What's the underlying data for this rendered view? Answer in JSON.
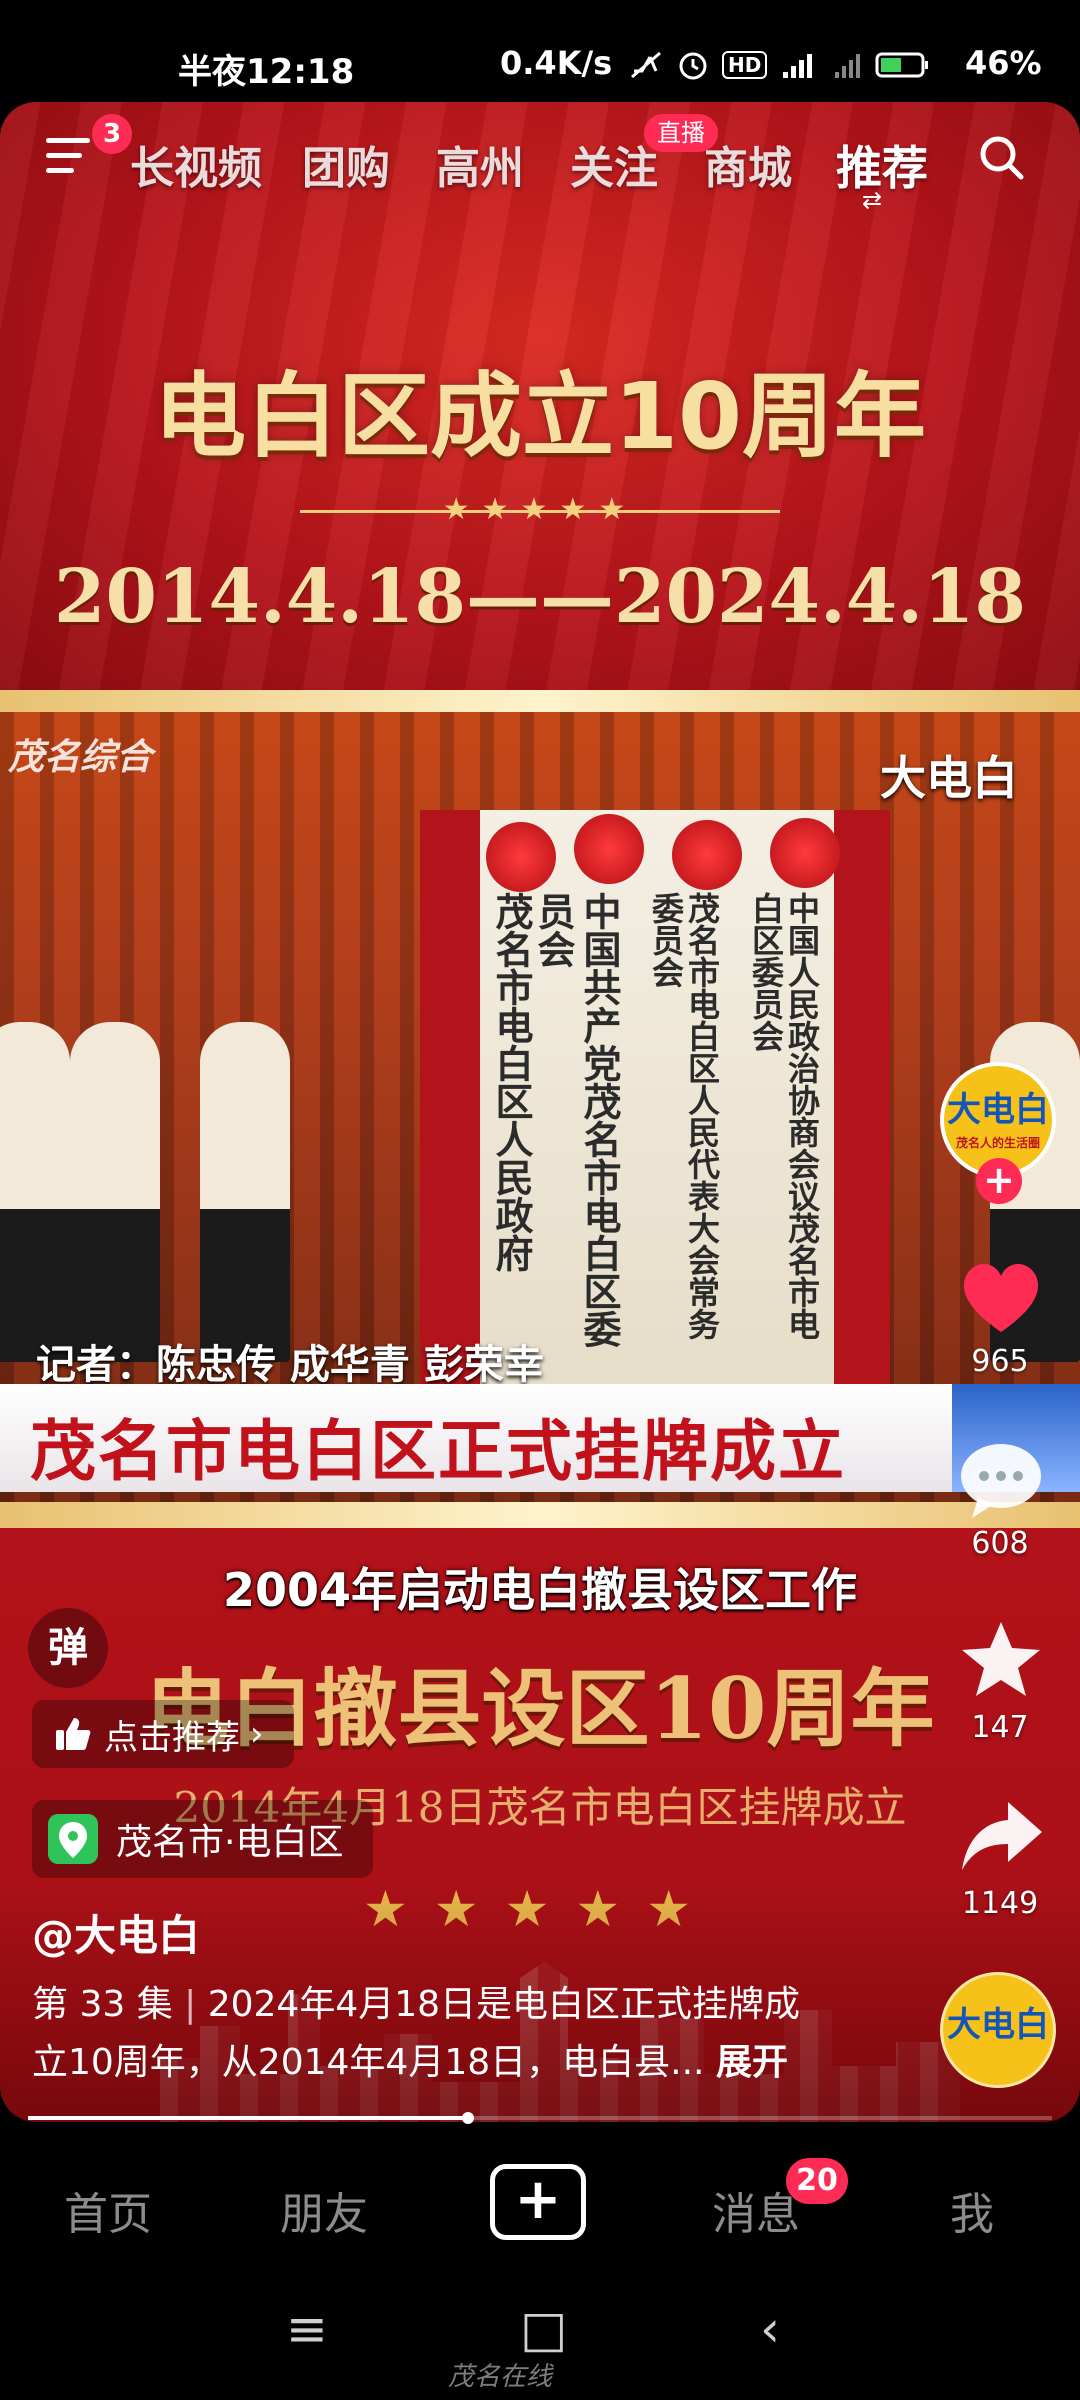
{
  "status_bar": {
    "time": "半夜12:18",
    "network_speed": "0.4K/s",
    "indicators": "HD 5G",
    "battery": "46%"
  },
  "top_nav": {
    "menu_badge": "3",
    "tabs": [
      {
        "label": "长视频"
      },
      {
        "label": "团购"
      },
      {
        "label": "高州"
      },
      {
        "label": "关注"
      },
      {
        "label": "商城"
      },
      {
        "label": "推荐"
      }
    ],
    "live_badge": "直播",
    "active_tab": "推荐"
  },
  "video": {
    "banner_title": "电白区成立10周年",
    "banner_stars": "★★★★★",
    "banner_dates": "2014.4.18——2024.4.18",
    "channel_logo": "茂名综合",
    "watermark": "大电白",
    "plaque_columns": [
      "茂名市电白区人民政府",
      "中国共产党茂名市电白区委员会",
      "茂名市电白区人民代表大会常务委员会",
      "中国人民政治协商会议茂名市电白区委员会"
    ],
    "reporters": "记者：陈忠传  成华青  彭荣幸",
    "lower_third": "茂名市电白区正式挂牌成立",
    "subtitle": "2004年启动电白撤县设区工作",
    "overlay_title": "电白撤县设区10周年",
    "overlay_date": "2014年4月18日茂名市电白区挂牌成立",
    "overlay_stars": "★★★★★"
  },
  "right_rail": {
    "avatar_text": "大电白",
    "avatar_sub": "茂名人的生活圈",
    "follow": "+",
    "likes": "965",
    "comments": "608",
    "favorites": "147",
    "shares": "1149",
    "disc_text": "大电白"
  },
  "left_overlay": {
    "danmu": "弹",
    "recommend": "点击推荐",
    "location": "茂名市·电白区",
    "author": "@大电白",
    "episode": "第 33 集",
    "description": "2024年4月18日是电白区正式挂牌成立10周年，从2014年4月18日，电白县...",
    "description_line1": "2024年4月18日是电白区正式挂牌成",
    "description_line2": "立10周年，从2014年4月18日，电白县...",
    "expand": "展开",
    "progress": 0.43
  },
  "bottom_tabs": {
    "home": "首页",
    "friends": "朋友",
    "create": "+",
    "messages": "消息",
    "messages_badge": "20",
    "me": "我"
  },
  "system_nav": {
    "menu": "≡",
    "home": "□",
    "back": "‹",
    "site_mark": "茂名在线"
  },
  "colors": {
    "accent": "#fe2c55",
    "banner_red": "#c3161d",
    "gold": "#f6dfa8"
  }
}
